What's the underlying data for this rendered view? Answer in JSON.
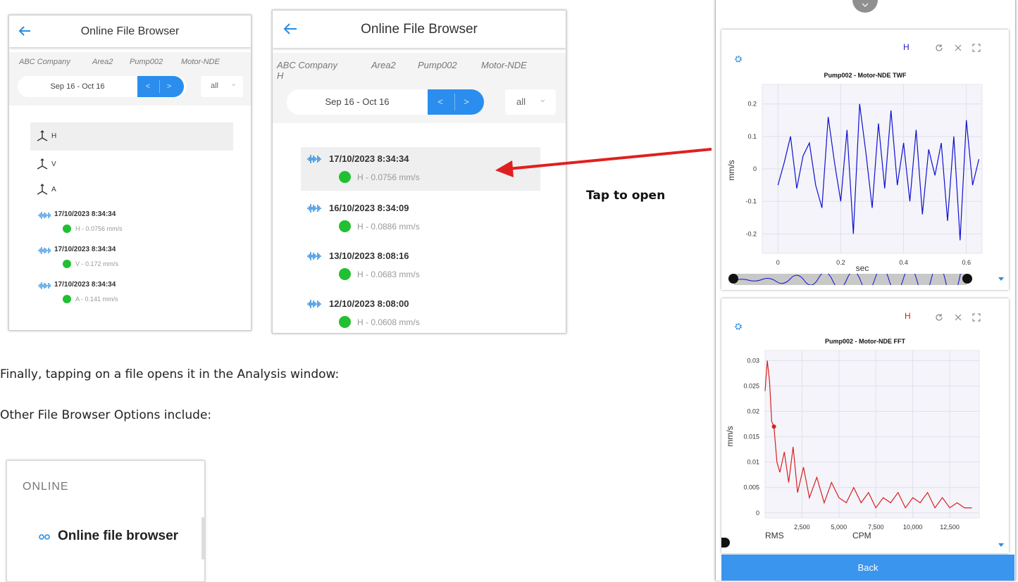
{
  "left_screen": {
    "back_icon": "arrow-left-icon",
    "title": "Online File Browser",
    "breadcrumbs": [
      "ABC Company",
      "Area2",
      "Pump002",
      "Motor-NDE"
    ],
    "date_range": "Sep 16 - Oct 16",
    "prev_label": "<",
    "next_label": ">",
    "filter_value": "all",
    "filter_caret": "⌄",
    "axes": [
      "H",
      "V",
      "A"
    ],
    "files": [
      {
        "datetime": "17/10/2023 8:34:34",
        "detail": "H - 0.0756 mm/s"
      },
      {
        "datetime": "17/10/2023 8:34:34",
        "detail": "V - 0.172 mm/s"
      },
      {
        "datetime": "17/10/2023 8:34:34",
        "detail": "A - 0.141 mm/s"
      }
    ]
  },
  "middle_screen": {
    "back_icon": "arrow-left-icon",
    "title": "Online File Browser",
    "breadcrumbs": [
      "ABC Company",
      "Area2",
      "Pump002",
      "Motor-NDE"
    ],
    "breadcrumb_wrap": "H",
    "date_range": "Sep 16 - Oct 16",
    "prev_label": "<",
    "next_label": ">",
    "filter_value": "all",
    "filter_caret": "⌄",
    "files": [
      {
        "datetime": "17/10/2023 8:34:34",
        "detail": "H - 0.0756 mm/s"
      },
      {
        "datetime": "16/10/2023 8:34:09",
        "detail": "H - 0.0886 mm/s"
      },
      {
        "datetime": "13/10/2023 8:08:16",
        "detail": "H - 0.0683 mm/s"
      },
      {
        "datetime": "12/10/2023 8:08:00",
        "detail": "H - 0.0608 mm/s"
      }
    ]
  },
  "annotation": {
    "tap_label": "Tap to open",
    "arrow_color": "#e02020"
  },
  "body_text": {
    "line1": "Finally, tapping on a file opens it in the Analysis window:",
    "line2": "Other File Browser Options include:"
  },
  "menu_snippet": {
    "section": "ONLINE",
    "item": "Online file browser",
    "item_icon": "waveform-icon"
  },
  "analysis": {
    "collapse_icon": "chevron-down-icon",
    "back_label": "Back",
    "twf": {
      "direction": "H",
      "settings_icon": "gear-icon",
      "refresh_icon": "refresh-icon",
      "close_icon": "close-icon",
      "expand_icon": "expand-icon",
      "series_color": "#1010d0"
    },
    "fft": {
      "direction": "H",
      "settings_icon": "gear-icon",
      "refresh_icon": "refresh-icon",
      "close_icon": "close-icon",
      "expand_icon": "expand-icon",
      "rms_label": "RMS",
      "series_color": "#d82020"
    }
  },
  "chart_data": [
    {
      "type": "line",
      "title": "Pump002 - Motor-NDE TWF",
      "xlabel": "sec",
      "ylabel": "mm/s",
      "xlim": [
        -0.05,
        0.65
      ],
      "ylim": [
        -0.26,
        0.26
      ],
      "xticks": [
        "0",
        "0.2",
        "0.4",
        "0.6"
      ],
      "yticks": [
        "0.2",
        "0.1",
        "0",
        "-0.1",
        "-0.2"
      ],
      "grid": true,
      "series": [
        {
          "x": [
            0,
            0.02,
            0.04,
            0.06,
            0.08,
            0.1,
            0.12,
            0.14,
            0.16,
            0.18,
            0.2,
            0.22,
            0.24,
            0.26,
            0.28,
            0.3,
            0.32,
            0.34,
            0.36,
            0.38,
            0.4,
            0.42,
            0.44,
            0.46,
            0.48,
            0.5,
            0.52,
            0.54,
            0.56,
            0.58,
            0.6,
            0.62,
            0.64
          ],
          "y": [
            -0.05,
            0.02,
            0.1,
            -0.06,
            0.04,
            0.08,
            -0.05,
            -0.12,
            0.16,
            0.02,
            -0.1,
            0.12,
            -0.2,
            0.2,
            0.05,
            -0.12,
            0.14,
            -0.06,
            0.18,
            -0.05,
            0.08,
            -0.1,
            0.12,
            -0.14,
            0.06,
            -0.02,
            0.08,
            -0.16,
            0.1,
            -0.22,
            0.15,
            -0.05,
            0.03
          ]
        }
      ]
    },
    {
      "type": "line",
      "title": "Pump002 - Motor-NDE FFT",
      "xlabel": "CPM",
      "ylabel": "mm/s",
      "xlim": [
        0,
        14500
      ],
      "ylim": [
        -0.001,
        0.032
      ],
      "xticks": [
        "2,500",
        "5,000",
        "7,500",
        "10,000",
        "12,500"
      ],
      "yticks": [
        "0.03",
        "0.025",
        "0.02",
        "0.015",
        "0.01",
        "0.005",
        "0"
      ],
      "grid": true,
      "series": [
        {
          "x": [
            0,
            150,
            300,
            450,
            600,
            800,
            1000,
            1300,
            1600,
            1900,
            2200,
            2600,
            3000,
            3500,
            4000,
            4500,
            5000,
            5500,
            6000,
            6500,
            7000,
            7500,
            8000,
            8500,
            9000,
            9500,
            10000,
            10500,
            11000,
            11500,
            12000,
            12500,
            13000,
            13500,
            14000
          ],
          "y": [
            0.024,
            0.03,
            0.026,
            0.018,
            0.017,
            0.01,
            0.008,
            0.012,
            0.006,
            0.013,
            0.004,
            0.009,
            0.003,
            0.007,
            0.002,
            0.006,
            0.003,
            0.002,
            0.005,
            0.002,
            0.004,
            0.001,
            0.003,
            0.002,
            0.004,
            0.001,
            0.003,
            0.002,
            0.004,
            0.001,
            0.003,
            0.001,
            0.002,
            0.001,
            0.001
          ]
        }
      ]
    }
  ]
}
